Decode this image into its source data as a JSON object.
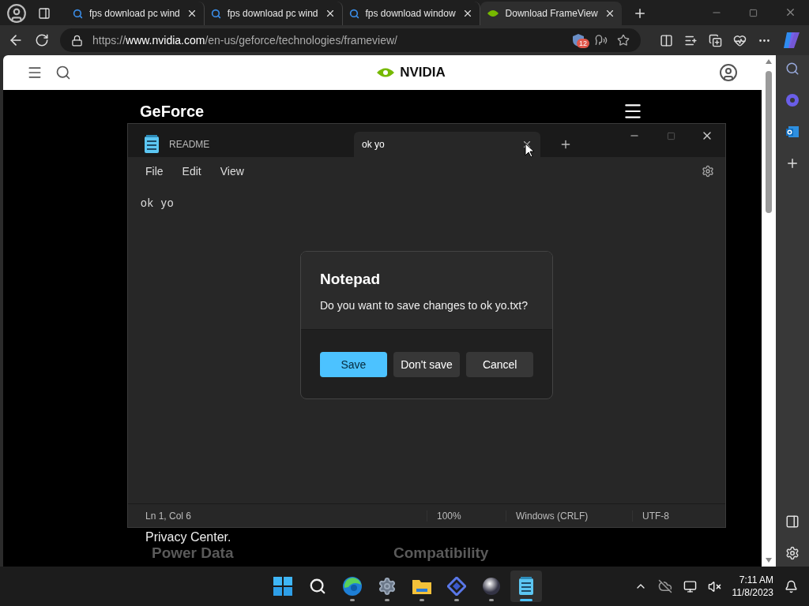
{
  "browser": {
    "tabs": [
      {
        "label": "fps download pc wind",
        "kind": "search",
        "selected": false
      },
      {
        "label": "fps download pc wind",
        "kind": "search",
        "selected": false
      },
      {
        "label": "fps download window",
        "kind": "search",
        "selected": false
      },
      {
        "label": "Download FrameView",
        "kind": "site",
        "selected": true
      }
    ],
    "address": {
      "protocol": "https://",
      "domain": "www.nvidia.com",
      "path": "/en-us/geforce/technologies/frameview/"
    },
    "tracker_badge": "12"
  },
  "page": {
    "logo": "NVIDIA",
    "heading": "GeForce",
    "privacy": "Privacy Center.",
    "faded": [
      "Power Data",
      "Compatibility"
    ]
  },
  "notepad": {
    "tabs": [
      {
        "label": "README",
        "selected": false
      },
      {
        "label": "ok yo",
        "selected": true
      }
    ],
    "menu": [
      "File",
      "Edit",
      "View"
    ],
    "content": "ok yo",
    "status": [
      "Ln 1, Col 6",
      "100%",
      "Windows (CRLF)",
      "UTF-8"
    ]
  },
  "dialog": {
    "title": "Notepad",
    "message": "Do you want to save changes to ok yo.txt?",
    "buttons": [
      {
        "label": "Save",
        "kind": "primary"
      },
      {
        "label": "Don't save",
        "kind": "secondary"
      },
      {
        "label": "Cancel",
        "kind": "secondary"
      }
    ]
  },
  "taskbar": {
    "apps": [
      {
        "kind": "start",
        "running": false,
        "selected": false
      },
      {
        "kind": "search",
        "running": false,
        "selected": false
      },
      {
        "kind": "edge",
        "running": true,
        "selected": false
      },
      {
        "kind": "settings",
        "running": true,
        "selected": false
      },
      {
        "kind": "explorer",
        "running": true,
        "selected": false
      },
      {
        "kind": "tool",
        "running": true,
        "selected": false
      },
      {
        "kind": "sphere",
        "running": true,
        "selected": false
      },
      {
        "kind": "notepad",
        "running": true,
        "selected": true
      }
    ],
    "time": "7:11 AM",
    "date": "11/8/2023"
  }
}
